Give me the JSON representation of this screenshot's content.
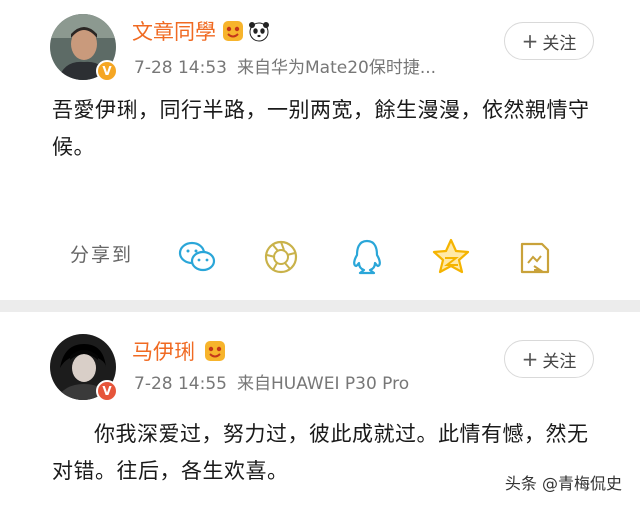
{
  "posts": [
    {
      "author": "文章同學",
      "date": "7-28 14:53",
      "source": "来自华为Mate20保时捷...",
      "follow_label": "关注",
      "content": "吾愛伊琍，同行半路，一别两宽，餘生漫漫，依然親情守候。",
      "share_label": "分享到",
      "share_targets": [
        "wechat-icon",
        "moments-icon",
        "qq-icon",
        "qzone-icon",
        "favorite-icon"
      ]
    },
    {
      "author": "马伊琍",
      "date": "7-28 14:55",
      "source": "来自HUAWEI P30 Pro",
      "follow_label": "关注",
      "content": "你我深爱过，努力过，彼此成就过。此情有憾，然无对错。往后，各生欢喜。"
    }
  ],
  "watermark": "头条 @青梅侃史",
  "colors": {
    "name": "#f06a22",
    "verified": "#f5a623",
    "share_icon": "#2aa6d8",
    "qzone_star": "#f5b400"
  }
}
